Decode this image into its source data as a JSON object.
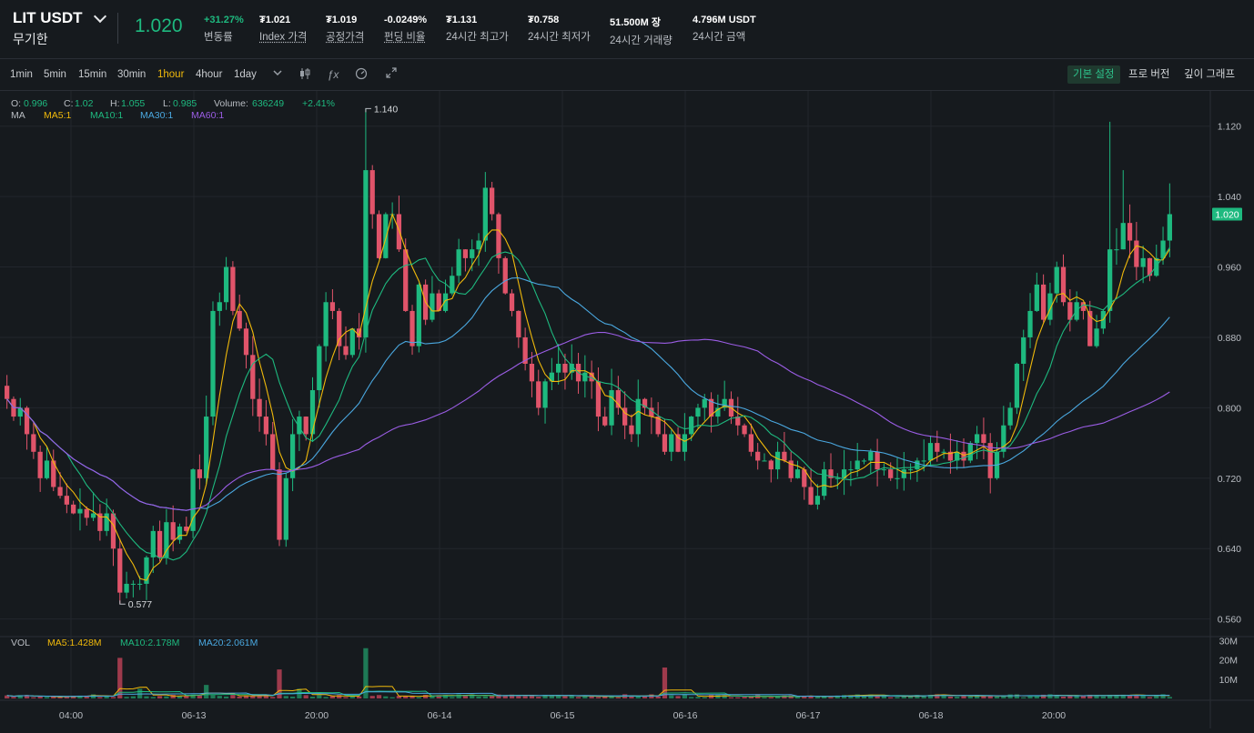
{
  "header": {
    "symbol": "LIT USDT",
    "contract_type": "무기한",
    "last_price": "1.020",
    "stats": [
      {
        "value": "+31.27%",
        "label": "변동률",
        "color": "#1eb97f",
        "underline": false
      },
      {
        "value": "₮1.021",
        "label": "Index 가격",
        "underline": true
      },
      {
        "value": "₮1.019",
        "label": "공정가격",
        "underline": true
      },
      {
        "value": "-0.0249%",
        "label": "펀딩 비율",
        "underline": true
      },
      {
        "value": "₮1.131",
        "label": "24시간 최고가",
        "underline": false
      },
      {
        "value": "₮0.758",
        "label": "24시간 최저가",
        "underline": false
      },
      {
        "value": "51.500M 장",
        "label": "24시간 거래량",
        "underline": false
      },
      {
        "value": "4.796M USDT",
        "label": "24시간 금액",
        "underline": false
      }
    ]
  },
  "toolbar": {
    "timeframes": [
      "1min",
      "5min",
      "15min",
      "30min",
      "1hour",
      "4hour",
      "1day"
    ],
    "active_timeframe": "1hour",
    "icons": [
      "chevron-down-icon",
      "candlestick-type-icon",
      "indicator-fx-icon",
      "settings-gauge-icon",
      "fullscreen-icon"
    ],
    "right_buttons": [
      "기본 설정",
      "프로 버전",
      "깊이 그래프"
    ],
    "active_right": "기본 설정"
  },
  "legend": {
    "ohlc": {
      "o_label": "O:",
      "o": "0.996",
      "c_label": "C:",
      "c": "1.02",
      "h_label": "H:",
      "h": "1.055",
      "l_label": "L:",
      "l": "0.985",
      "vol_label": "Volume:",
      "vol": "636249",
      "change": "+2.41%"
    },
    "ma_label": "MA",
    "ma": [
      {
        "text": "MA5:1",
        "color": "#f0b90b"
      },
      {
        "text": "MA10:1",
        "color": "#1eb97f"
      },
      {
        "text": "MA30:1",
        "color": "#4aa8e0"
      },
      {
        "text": "MA60:1",
        "color": "#9b5de5"
      }
    ]
  },
  "volume_legend": {
    "label": "VOL",
    "ma": [
      {
        "text": "MA5:1.428M",
        "color": "#f0b90b"
      },
      {
        "text": "MA10:2.178M",
        "color": "#1eb97f"
      },
      {
        "text": "MA20:2.061M",
        "color": "#4aa8e0"
      }
    ]
  },
  "chart_data": {
    "type": "candlestick",
    "title": "",
    "price_axis_ticks": [
      "1.120",
      "1.040",
      "0.960",
      "0.880",
      "0.800",
      "0.720",
      "0.640",
      "0.560"
    ],
    "price_ylim": [
      0.54,
      1.16
    ],
    "volume_axis_ticks": [
      "30M",
      "20M",
      "10M"
    ],
    "volume_ylim": [
      0,
      32
    ],
    "time_labels": [
      "04:00",
      "06-13",
      "20:00",
      "06-14",
      "06-15",
      "06-16",
      "06-17",
      "06-18",
      "20:00"
    ],
    "current_price_label": "1.020",
    "annotations": [
      {
        "text": "1.140",
        "value": 1.14,
        "kind": "high"
      },
      {
        "text": "0.577",
        "value": 0.577,
        "kind": "low"
      }
    ],
    "colors": {
      "up": "#1eb97f",
      "down": "#e0546a",
      "ma5": "#f0b90b",
      "ma10": "#1eb97f",
      "ma30": "#4aa8e0",
      "ma60": "#9b5de5",
      "grid": "#22262c"
    },
    "closes": [
      0.81,
      0.79,
      0.8,
      0.77,
      0.75,
      0.72,
      0.74,
      0.71,
      0.7,
      0.69,
      0.68,
      0.685,
      0.675,
      0.68,
      0.66,
      0.68,
      0.64,
      0.59,
      0.6,
      0.6,
      0.6,
      0.63,
      0.66,
      0.63,
      0.67,
      0.65,
      0.665,
      0.66,
      0.73,
      0.72,
      0.79,
      0.91,
      0.92,
      0.96,
      0.91,
      0.89,
      0.86,
      0.81,
      0.79,
      0.77,
      0.73,
      0.65,
      0.72,
      0.77,
      0.79,
      0.77,
      0.82,
      0.87,
      0.92,
      0.91,
      0.87,
      0.86,
      0.89,
      0.88,
      1.07,
      1.02,
      0.97,
      1.02,
      1.02,
      0.98,
      0.91,
      0.87,
      0.94,
      0.9,
      0.93,
      0.91,
      0.93,
      0.95,
      0.98,
      0.97,
      0.98,
      0.99,
      1.05,
      1.02,
      0.97,
      0.93,
      0.91,
      0.88,
      0.85,
      0.83,
      0.8,
      0.83,
      0.84,
      0.85,
      0.84,
      0.85,
      0.83,
      0.84,
      0.83,
      0.79,
      0.78,
      0.82,
      0.8,
      0.78,
      0.77,
      0.81,
      0.8,
      0.79,
      0.77,
      0.75,
      0.77,
      0.75,
      0.77,
      0.79,
      0.8,
      0.81,
      0.79,
      0.8,
      0.81,
      0.79,
      0.78,
      0.77,
      0.75,
      0.74,
      0.74,
      0.73,
      0.75,
      0.74,
      0.72,
      0.73,
      0.71,
      0.69,
      0.7,
      0.73,
      0.72,
      0.72,
      0.73,
      0.73,
      0.74,
      0.74,
      0.75,
      0.73,
      0.73,
      0.72,
      0.72,
      0.73,
      0.73,
      0.74,
      0.74,
      0.76,
      0.75,
      0.75,
      0.74,
      0.75,
      0.74,
      0.76,
      0.77,
      0.76,
      0.72,
      0.75,
      0.78,
      0.8,
      0.85,
      0.88,
      0.91,
      0.94,
      0.9,
      0.93,
      0.96,
      0.92,
      0.9,
      0.92,
      0.91,
      0.87,
      0.89,
      0.91,
      0.98,
      0.98,
      1.01,
      0.99,
      0.96,
      0.97,
      0.95,
      0.97,
      0.99,
      1.02
    ]
  }
}
